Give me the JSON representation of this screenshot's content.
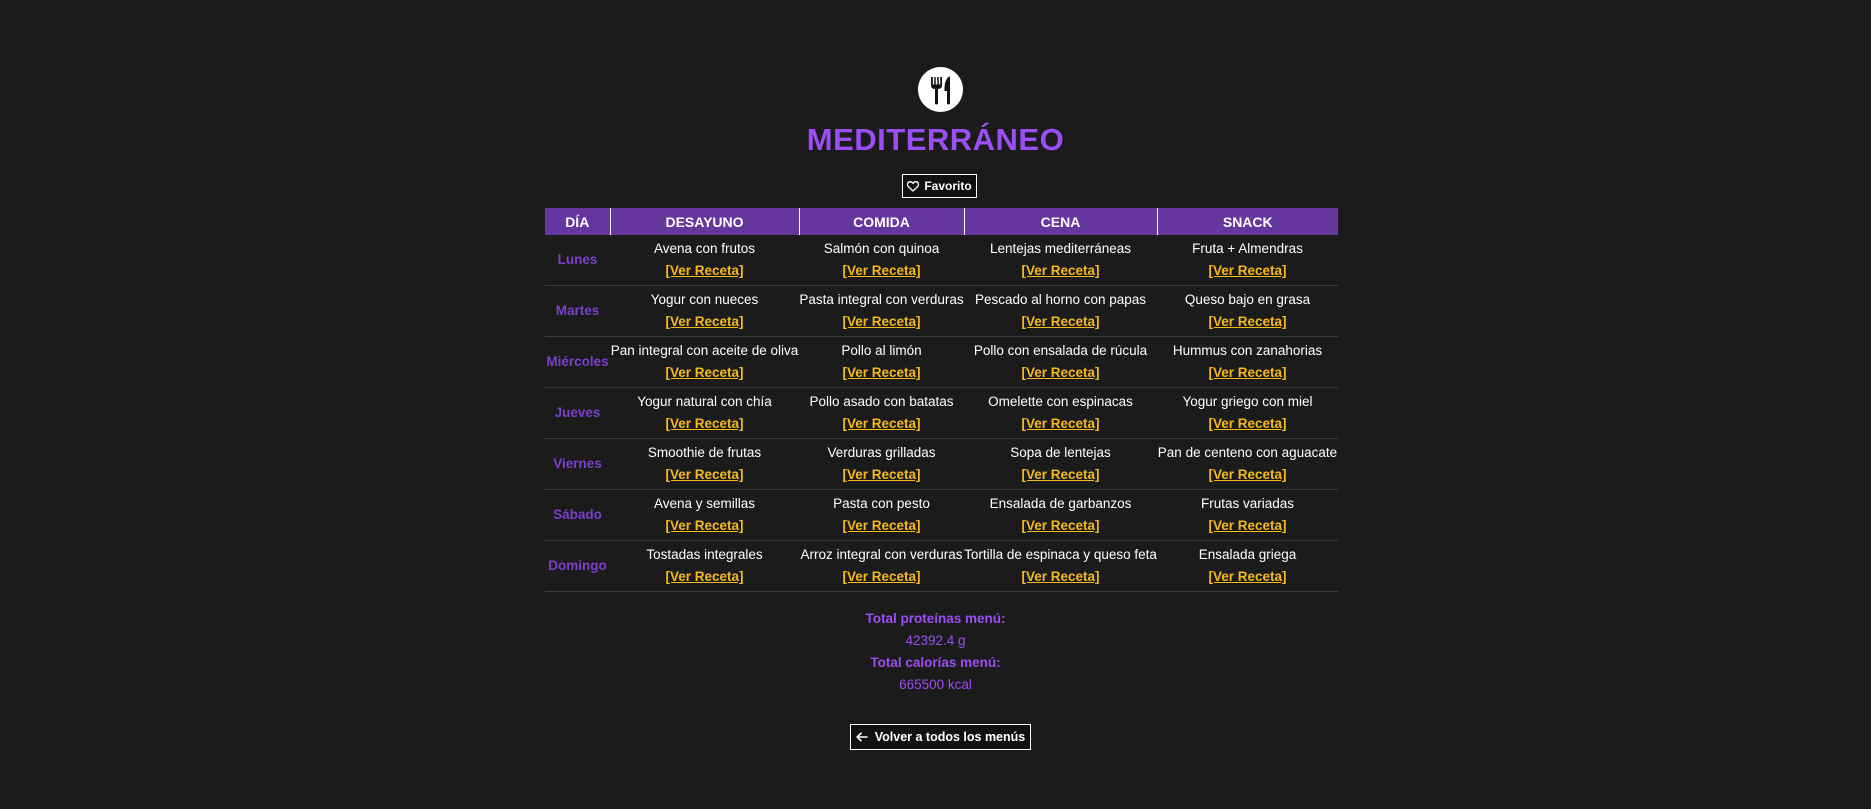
{
  "menu": {
    "title": "MEDITERRÁNEO",
    "favorite_label": "Favorito"
  },
  "table": {
    "headers": [
      "DÍA",
      "DESAYUNO",
      "COMIDA",
      "CENA",
      "SNACK"
    ],
    "recipe_link_label": "[Ver Receta]",
    "rows": [
      {
        "day": "Lunes",
        "meals": [
          "Avena con frutos",
          "Salmón con quinoa",
          "Lentejas mediterráneas",
          "Fruta + Almendras"
        ]
      },
      {
        "day": "Martes",
        "meals": [
          "Yogur con nueces",
          "Pasta integral con verduras",
          "Pescado al horno con papas",
          "Queso bajo en grasa"
        ]
      },
      {
        "day": "Miércoles",
        "meals": [
          "Pan integral con aceite de oliva",
          "Pollo al limón",
          "Pollo con ensalada de rúcula",
          "Hummus con zanahorias"
        ]
      },
      {
        "day": "Jueves",
        "meals": [
          "Yogur natural con chía",
          "Pollo asado con batatas",
          "Omelette con espinacas",
          "Yogur griego con miel"
        ]
      },
      {
        "day": "Viernes",
        "meals": [
          "Smoothie de frutas",
          "Verduras grilladas",
          "Sopa de lentejas",
          "Pan de centeno con aguacate"
        ]
      },
      {
        "day": "Sábado",
        "meals": [
          "Avena y semillas",
          "Pasta con pesto",
          "Ensalada de garbanzos",
          "Frutas variadas"
        ]
      },
      {
        "day": "Domingo",
        "meals": [
          "Tostadas integrales",
          "Arroz integral con verduras",
          "Tortilla de espinaca y queso feta",
          "Ensalada griega"
        ]
      }
    ]
  },
  "totals": {
    "protein_label": "Total proteínas menú:",
    "protein_value": "42392.4 g",
    "calories_label": "Total calorías menú:",
    "calories_value": "665500 kcal"
  },
  "back_button_label": "Volver a todos los menús",
  "icons": {
    "logo": "utensils-icon",
    "favorite": "heart-outline-icon",
    "back": "arrow-left-icon"
  },
  "colors": {
    "background": "#1b1b1b",
    "accent_purple": "#9a4ef3",
    "header_purple": "#66369f",
    "day_purple": "#7b3fc9",
    "link_yellow": "#f5b91a"
  }
}
